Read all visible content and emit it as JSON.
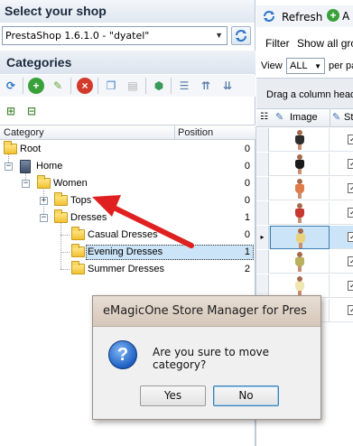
{
  "shop_panel": {
    "title": "Select your shop",
    "selected_shop": "PrestaShop 1.6.1.0 - \"dyatel\""
  },
  "categories_panel": {
    "title": "Categories",
    "columns": {
      "category": "Category",
      "position": "Position"
    },
    "tree": [
      {
        "label": "Root",
        "position": "0"
      },
      {
        "label": "Home",
        "position": "0"
      },
      {
        "label": "Women",
        "position": "0"
      },
      {
        "label": "Tops",
        "position": "0"
      },
      {
        "label": "Dresses",
        "position": "1"
      },
      {
        "label": "Casual Dresses",
        "position": "0"
      },
      {
        "label": "Evening Dresses",
        "position": "1"
      },
      {
        "label": "Summer Dresses",
        "position": "2"
      }
    ]
  },
  "products_panel": {
    "toolbar": {
      "refresh": "Refresh",
      "add": "A"
    },
    "filter": {
      "label": "Filter",
      "value": "Show all gro"
    },
    "view": {
      "label": "View",
      "value": "ALL",
      "per_page": "per pa"
    },
    "drag_hint": "Drag a column head",
    "grid_columns": {
      "image": "Image",
      "status": "St"
    },
    "dress_colors": [
      "#2d2d2d",
      "#1a1a1a",
      "#e07b4a",
      "#c7372f",
      "#e8d27a",
      "#b8b05a",
      "#f0e6b0",
      "#f4d24a"
    ]
  },
  "dialog": {
    "title": "eMagicOne Store Manager for Pres",
    "message": "Are you sure to move category?",
    "yes": "Yes",
    "no": "No"
  },
  "colors": {
    "arrow": "#e02020",
    "selection": "#cce4f7",
    "accent": "#3c7fb1"
  },
  "icons": {
    "refresh": "refresh-icon",
    "add": "add-icon",
    "edit": "edit-icon",
    "delete": "delete-icon",
    "question": "question-icon"
  }
}
